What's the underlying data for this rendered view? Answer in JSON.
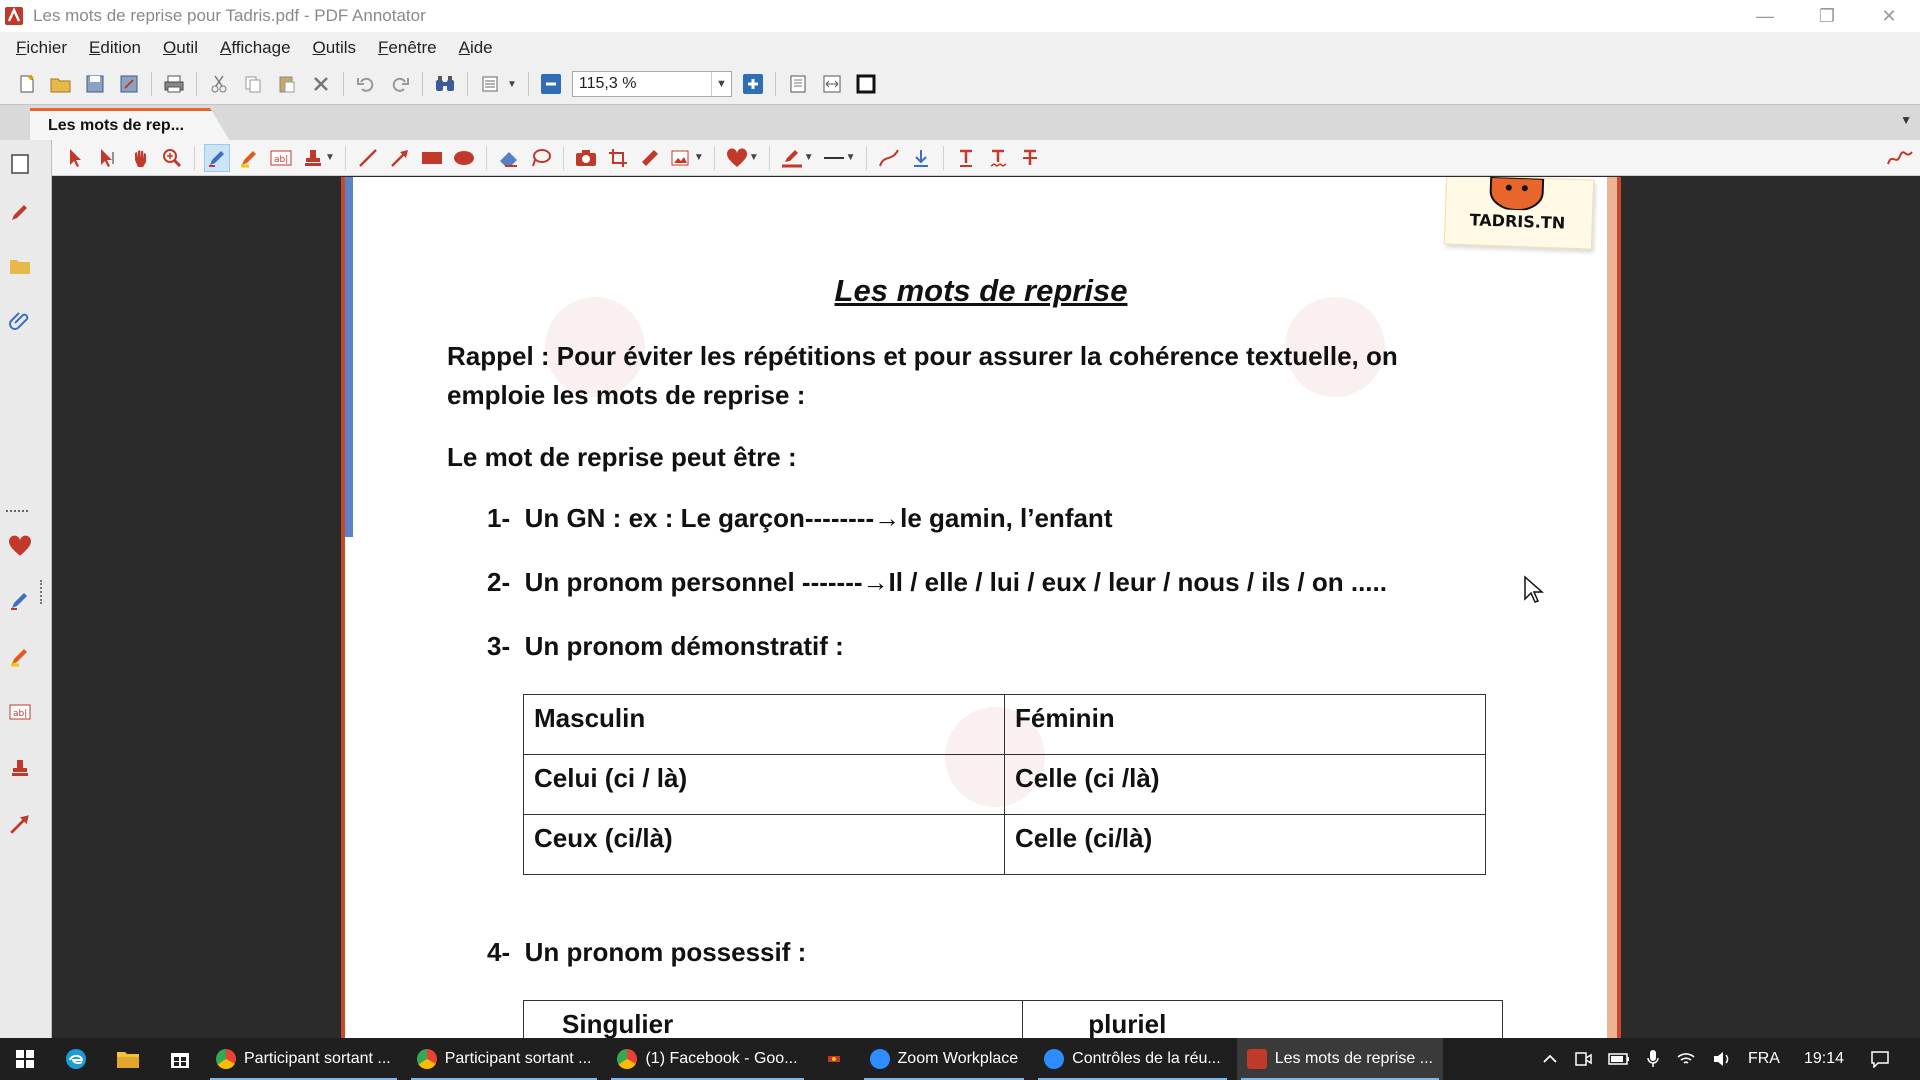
{
  "window": {
    "title": "Les mots de reprise pour Tadris.pdf - PDF Annotator",
    "minimize": "—",
    "restore": "❐",
    "close": "✕"
  },
  "menu": [
    "Fichier",
    "Edition",
    "Outil",
    "Affichage",
    "Outils",
    "Fenêtre",
    "Aide"
  ],
  "toolbar": {
    "zoom_value": "115,3 %"
  },
  "tab": {
    "label": "Les mots de rep..."
  },
  "document": {
    "logo_text": "TADRIS.TN",
    "title": "Les mots de reprise",
    "rappel_line1": "Rappel : Pour éviter les répétitions et pour assurer la cohérence textuelle, on",
    "rappel_line2": "emploie les mots de reprise :",
    "intro": "Le mot de reprise peut être :",
    "items": [
      {
        "num": "1-",
        "text": "Un GN : ex : Le garçon--------→le gamin, l’enfant"
      },
      {
        "num": "2-",
        "text": "Un pronom personnel -------→Il / elle / lui / eux / leur / nous / ils / on ....."
      },
      {
        "num": "3-",
        "text": "Un pronom démonstratif :"
      },
      {
        "num": "4-",
        "text": "Un pronom possessif :"
      }
    ],
    "demo_table": [
      [
        "Masculin",
        "Féminin"
      ],
      [
        "Celui (ci / là)",
        "Celle (ci /là)"
      ],
      [
        "Ceux (ci/là)",
        "Celle (ci/là)"
      ]
    ],
    "poss_table_header": [
      "Singulier",
      "pluriel"
    ]
  },
  "taskbar": {
    "apps": [
      {
        "label": "Participant sortant ...",
        "icon_color": "#4285f4"
      },
      {
        "label": "Participant sortant ...",
        "icon_color": "#4285f4"
      },
      {
        "label": "(1) Facebook - Goo...",
        "icon_color": "#4285f4"
      },
      {
        "label": "Zoom Workplace",
        "icon_color": "#2d8cff"
      },
      {
        "label": "Contrôles de la réu...",
        "icon_color": "#2d8cff"
      },
      {
        "label": "Les mots de reprise ...",
        "icon_color": "#c0392b"
      }
    ],
    "language": "FRA",
    "time": "19:14"
  },
  "colors": {
    "accent": "#e8662b",
    "page_border": "#c94a2a",
    "tab_accent": "#e8662b",
    "taskbar": "#1f1f1f"
  }
}
